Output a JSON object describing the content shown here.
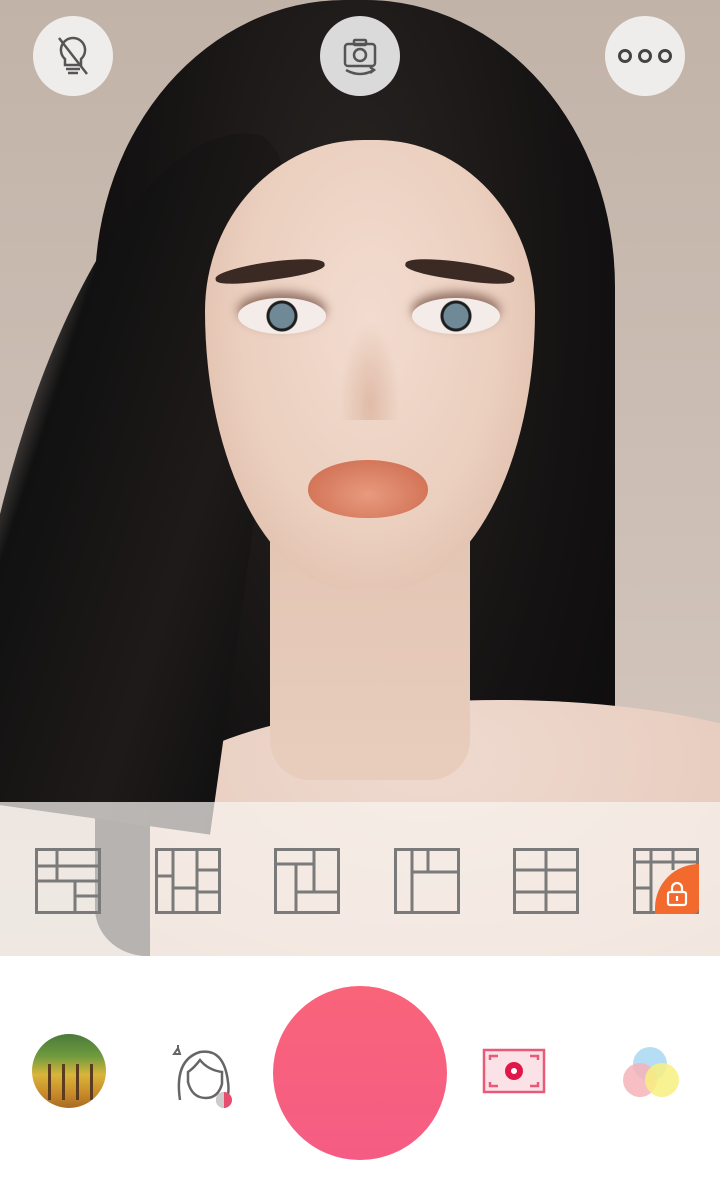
{
  "camera": {
    "top_left_button": "bulb-off-icon",
    "top_center_button": "switch-camera-icon",
    "top_right_button": "more-icon"
  },
  "layouts": [
    {
      "name": "layout-grid-1",
      "locked": false
    },
    {
      "name": "layout-grid-2",
      "locked": false
    },
    {
      "name": "layout-grid-3",
      "locked": false
    },
    {
      "name": "layout-grid-4",
      "locked": false
    },
    {
      "name": "layout-grid-5",
      "locked": false
    },
    {
      "name": "layout-grid-6",
      "locked": true
    }
  ],
  "bottom_bar": {
    "gallery": "gallery-thumbnail",
    "beauty": "beauty-face-icon",
    "shutter": "shutter-button",
    "frame": "frame-icon",
    "filter": "filter-icon"
  },
  "colors": {
    "shutter": "#F75F80",
    "accent": "#E85A78",
    "lock_badge": "#F26A2D",
    "layout_icon": "#7A7A7A"
  }
}
